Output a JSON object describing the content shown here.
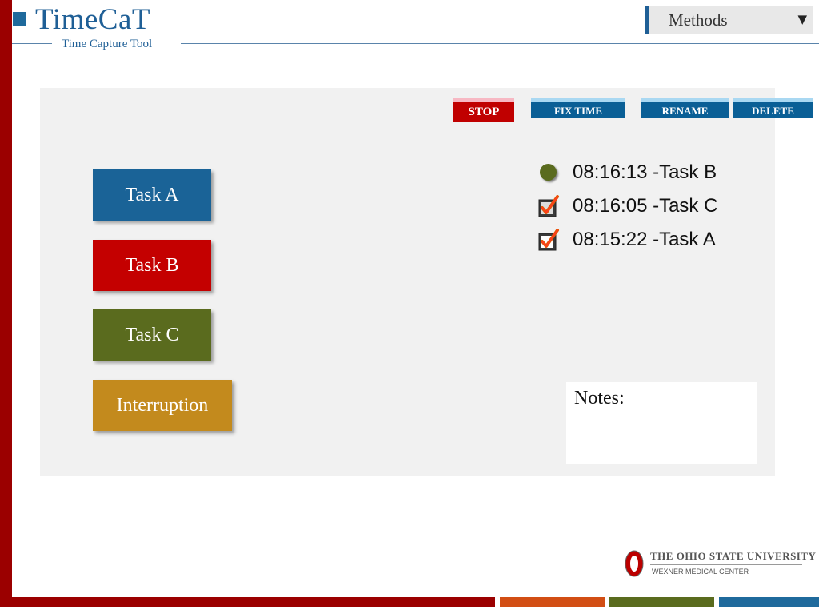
{
  "app": {
    "title": "TimeCaT",
    "subtitle": "Time Capture Tool"
  },
  "methods_dropdown": {
    "selected": "Methods",
    "caret": "▼"
  },
  "toolbar": {
    "stop_label": "STOP",
    "fix_time_label": "FIX TIME",
    "rename_label": "RENAME",
    "delete_label": "DELETE"
  },
  "tasks": [
    {
      "label": "Task A",
      "color": "#1a6397"
    },
    {
      "label": "Task B",
      "color": "#c40000"
    },
    {
      "label": "Task C",
      "color": "#5a6b1e"
    },
    {
      "label": "Interruption",
      "color": "#c38a1d"
    }
  ],
  "log": [
    {
      "text": "08:16:13 -Task B",
      "status_icon": "active-dot-icon"
    },
    {
      "text": "08:16:05 -Task C",
      "status_icon": "checkbox-checked-icon"
    },
    {
      "text": "08:15:22 -Task A",
      "status_icon": "checkbox-checked-icon"
    }
  ],
  "notes": {
    "label": "Notes:"
  },
  "footer": {
    "university_name": "THE OHIO STATE UNIVERSITY",
    "center_name": "WEXNER MEDICAL CENTER"
  },
  "colors": {
    "brand_red": "#9b0000",
    "brand_blue": "#1f6a9c",
    "accent_orange": "#d24e14",
    "accent_green": "#5a6b1e"
  }
}
